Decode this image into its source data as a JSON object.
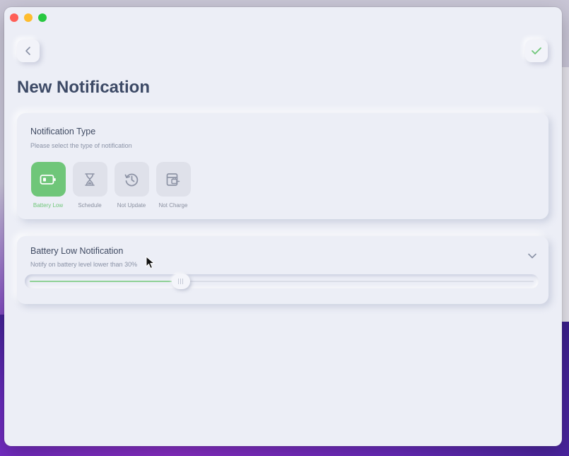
{
  "page": {
    "title": "New Notification"
  },
  "notification_type": {
    "title": "Notification Type",
    "subtitle": "Please select the type of notification",
    "options": [
      {
        "label": "Battery Low",
        "icon": "battery-icon",
        "selected": true
      },
      {
        "label": "Schedule",
        "icon": "hourglass-icon",
        "selected": false
      },
      {
        "label": "Not Update",
        "icon": "history-icon",
        "selected": false
      },
      {
        "label": "Not Charge",
        "icon": "charger-icon",
        "selected": false
      }
    ]
  },
  "battery_low": {
    "title": "Battery Low Notification",
    "subtitle": "Notify on battery level lower than 30%",
    "threshold_percent": 30
  },
  "colors": {
    "accent": "#6fc679",
    "window_bg": "#eceef6",
    "title": "#3d4a66"
  }
}
